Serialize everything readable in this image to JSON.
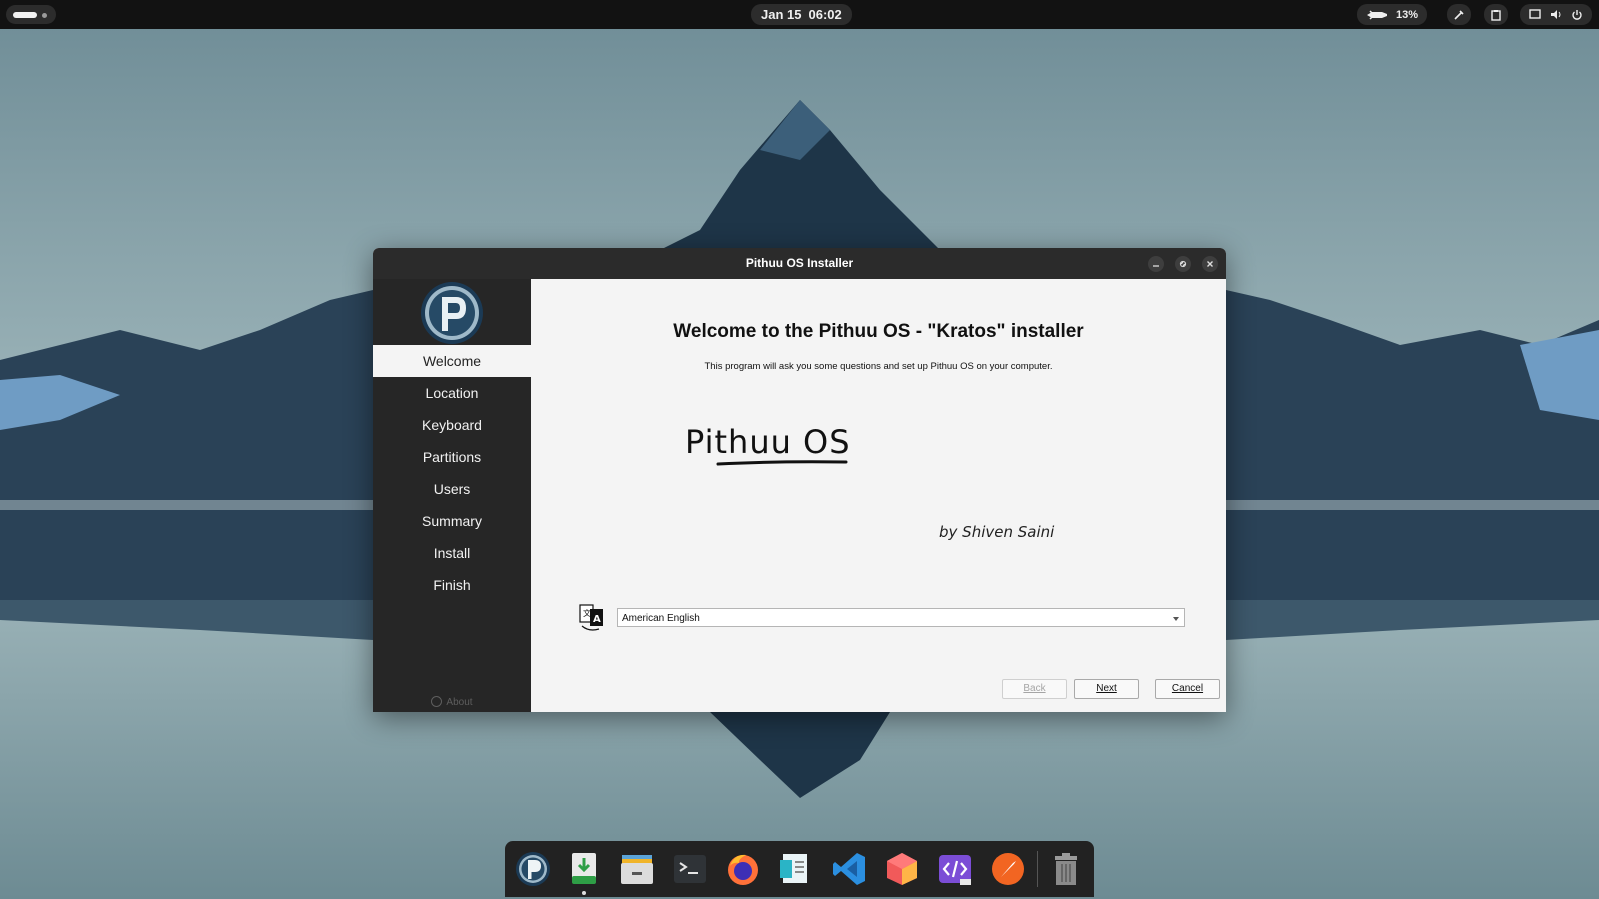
{
  "topbar": {
    "date": "Jan 15",
    "time": "06:02",
    "battery_percent": "13%"
  },
  "window": {
    "title": "Pithuu OS Installer",
    "sidebar": {
      "steps": [
        {
          "label": "Welcome",
          "active": true
        },
        {
          "label": "Location",
          "active": false
        },
        {
          "label": "Keyboard",
          "active": false
        },
        {
          "label": "Partitions",
          "active": false
        },
        {
          "label": "Users",
          "active": false
        },
        {
          "label": "Summary",
          "active": false
        },
        {
          "label": "Install",
          "active": false
        },
        {
          "label": "Finish",
          "active": false
        }
      ],
      "about_label": "About"
    },
    "content": {
      "heading": "Welcome to the Pithuu OS - \"Kratos\" installer",
      "subtext": "This program will ask you some questions and set up Pithuu OS on your computer.",
      "brand_text": "Pithuu OS",
      "byline": "by Shiven Saini",
      "language_selected": "American English"
    },
    "buttons": {
      "back": "Back",
      "next": "Next",
      "cancel": "Cancel"
    }
  },
  "dock": {
    "items": [
      {
        "icon": "pithuu-logo-icon"
      },
      {
        "icon": "installer-download-icon"
      },
      {
        "icon": "files-icon"
      },
      {
        "icon": "terminal-icon"
      },
      {
        "icon": "firefox-icon"
      },
      {
        "icon": "document-viewer-icon"
      },
      {
        "icon": "vscode-icon"
      },
      {
        "icon": "box-app-icon"
      },
      {
        "icon": "code-editor-pre-icon"
      },
      {
        "icon": "compass-icon"
      },
      {
        "icon": "trash-icon"
      }
    ]
  },
  "colors": {
    "sidebar_bg": "#262626",
    "titlebar_bg": "#2b2b2b",
    "content_bg": "#f4f4f4",
    "topbar_bg": "#121212"
  }
}
